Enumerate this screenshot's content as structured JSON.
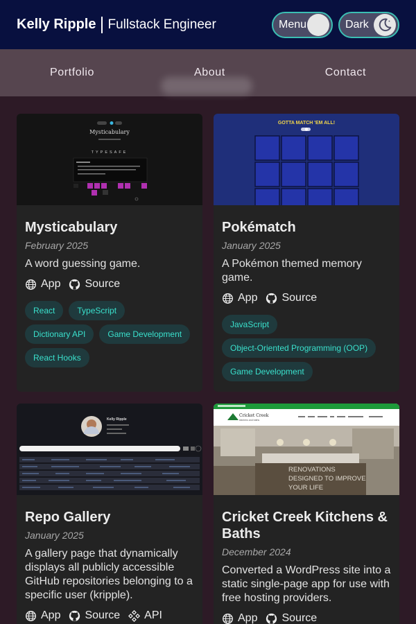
{
  "header": {
    "name": "Kelly Ripple",
    "role": "Fullstack Engineer",
    "menu_label": "Menu",
    "dark_label": "Dark"
  },
  "nav": [
    "Portfolio",
    "About",
    "Contact"
  ],
  "projects": [
    {
      "title": "Mysticabulary",
      "date": "February 2025",
      "description": "A word guessing game.",
      "links": [
        "App",
        "Source"
      ],
      "tags": [
        "React",
        "TypeScript",
        "Dictionary API",
        "Game Development",
        "React Hooks"
      ],
      "thumb": {
        "title": "Mysticabulary",
        "word": "TYPESAFE"
      }
    },
    {
      "title": "Pokématch",
      "date": "January 2025",
      "description": "A Pokémon themed memory game.",
      "links": [
        "App",
        "Source"
      ],
      "tags": [
        "JavaScript",
        "Object-Oriented Programming (OOP)",
        "Game Development"
      ],
      "thumb": {
        "banner": "GOTTA MATCH 'EM ALL!"
      }
    },
    {
      "title": "Repo Gallery",
      "date": "January 2025",
      "description": "A gallery page that dynamically displays all publicly accessible GitHub repositories belonging to a specific user (kripple).",
      "links": [
        "App",
        "Source",
        "API"
      ],
      "tags": [],
      "thumb": {
        "name": "Kelly Ripple"
      }
    },
    {
      "title": "Cricket Creek Kitchens & Baths",
      "date": "December 2024",
      "description": "Converted a WordPress site into a static single-page app for use with free hosting providers.",
      "links": [
        "App",
        "Source"
      ],
      "tags": [],
      "thumb": {
        "brand": "Cricket Creek",
        "sub": "kitchens and baths",
        "overlay": "RENOVATIONS DESIGNED TO IMPROVE YOUR LIFE"
      }
    }
  ],
  "colors": {
    "header": "#08103f",
    "nav": "#56454f",
    "page": "#2d1a26",
    "card": "#232323",
    "accent": "#3ae0cc"
  }
}
